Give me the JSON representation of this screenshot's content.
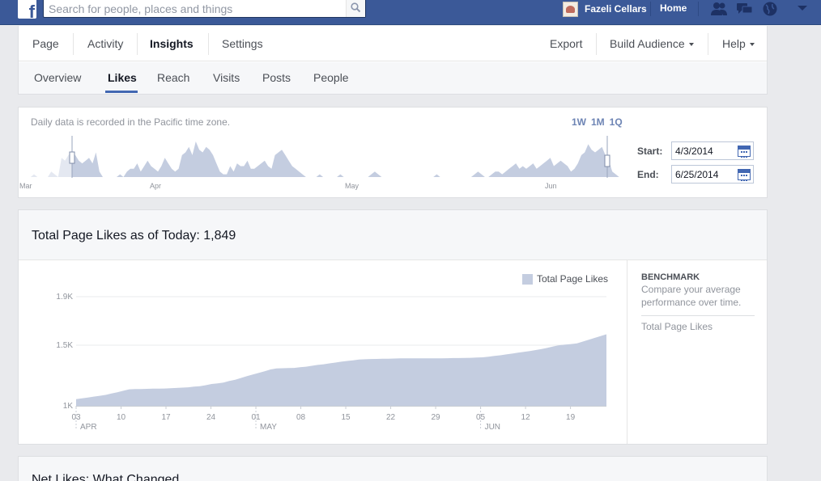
{
  "topbar": {
    "logo": "f",
    "search_placeholder": "Search for people, places and things",
    "account_name": "Fazeli Cellars",
    "home_label": "Home",
    "brand_color": "#3b5998"
  },
  "nav": {
    "tabs": [
      {
        "label": "Page"
      },
      {
        "label": "Activity"
      },
      {
        "label": "Insights",
        "active": true
      },
      {
        "label": "Settings"
      }
    ],
    "right": [
      {
        "label": "Export"
      },
      {
        "label": "Build Audience"
      },
      {
        "label": "Help"
      }
    ],
    "subtabs": [
      {
        "label": "Overview"
      },
      {
        "label": "Likes",
        "active": true
      },
      {
        "label": "Reach"
      },
      {
        "label": "Visits"
      },
      {
        "label": "Posts"
      },
      {
        "label": "People"
      }
    ]
  },
  "range": {
    "note": "Daily data is recorded in the Pacific time zone.",
    "presets": [
      "1W",
      "1M",
      "1Q"
    ],
    "start_label": "Start:",
    "start_value": "4/3/2014",
    "end_label": "End:",
    "end_value": "6/25/2014",
    "months": [
      "Mar",
      "Apr",
      "May",
      "Jun"
    ]
  },
  "likes": {
    "title": "Total Page Likes as of Today: 1,849",
    "legend": "Total Page Likes",
    "benchmark_title": "BENCHMARK",
    "benchmark_desc": "Compare your average performance over time.",
    "benchmark_link": "Total Page Likes"
  },
  "net": {
    "title": "Net Likes: What Changed"
  },
  "chart_data": {
    "type": "area",
    "series": [
      {
        "name": "Total Page Likes",
        "color": "#c4cde0",
        "values": [
          1055,
          1062,
          1069,
          1076,
          1083,
          1090,
          1101,
          1112,
          1124,
          1136,
          1138,
          1139,
          1140,
          1141,
          1142,
          1143,
          1145,
          1147,
          1150,
          1153,
          1158,
          1162,
          1170,
          1180,
          1185,
          1192,
          1205,
          1215,
          1230,
          1245,
          1258,
          1272,
          1285,
          1300,
          1308,
          1310,
          1312,
          1313,
          1318,
          1323,
          1330,
          1337,
          1343,
          1350,
          1357,
          1364,
          1370,
          1375,
          1381,
          1384,
          1386,
          1387,
          1388,
          1389,
          1390,
          1391,
          1391,
          1392,
          1392,
          1392,
          1392,
          1392,
          1392,
          1393,
          1394,
          1394,
          1395,
          1396,
          1398,
          1400,
          1405,
          1411,
          1417,
          1424,
          1431,
          1438,
          1445,
          1452,
          1460,
          1468,
          1478,
          1490,
          1500,
          1505,
          1509,
          1515,
          1530,
          1545,
          1560,
          1575,
          1590
        ]
      }
    ],
    "x_ticks": [
      "03",
      "10",
      "17",
      "24",
      "01",
      "08",
      "15",
      "22",
      "29",
      "05",
      "12",
      "19"
    ],
    "x_months": [
      "APR",
      "MAY",
      "JUN"
    ],
    "y_ticks": [
      "1K",
      "1.5K",
      "1.9K"
    ],
    "ylim": [
      1000,
      1900
    ],
    "grid": true,
    "legend_position": "top-right"
  },
  "sparkline": {
    "values": [
      0,
      0,
      0,
      0,
      1,
      0,
      0,
      0,
      0,
      2,
      1,
      0,
      7,
      6,
      8,
      9,
      8,
      6,
      5,
      6,
      7,
      5,
      9,
      2,
      0,
      0,
      0,
      0,
      0,
      1,
      0,
      2,
      3,
      3,
      5,
      2,
      4,
      6,
      4,
      3,
      2,
      4,
      7,
      5,
      3,
      2,
      3,
      8,
      9,
      11,
      8,
      13,
      10,
      9,
      11,
      10,
      8,
      5,
      2,
      1,
      1,
      4,
      2,
      5,
      4,
      4,
      6,
      3,
      3,
      4,
      5,
      6,
      4,
      3,
      8,
      9,
      10,
      8,
      6,
      4,
      3,
      2,
      1,
      0,
      0,
      0,
      0,
      1,
      0,
      0,
      0,
      0,
      0,
      1,
      0,
      0,
      0,
      0,
      0,
      0,
      0,
      0,
      1,
      2,
      1,
      0,
      0,
      0,
      0,
      0,
      0,
      0,
      0,
      0,
      0,
      0,
      0,
      0,
      0,
      0,
      0,
      1,
      0,
      0,
      0,
      0,
      0,
      0,
      0,
      0,
      0,
      0,
      1,
      2,
      1,
      0,
      0,
      1,
      2,
      2,
      1,
      2,
      3,
      4,
      5,
      3,
      4,
      3,
      4,
      5,
      3,
      4,
      5,
      6,
      7,
      4,
      5,
      6,
      5,
      4,
      2,
      3,
      5,
      8,
      9,
      12,
      10,
      9,
      10,
      11,
      8,
      6,
      2,
      1,
      0,
      0
    ]
  }
}
